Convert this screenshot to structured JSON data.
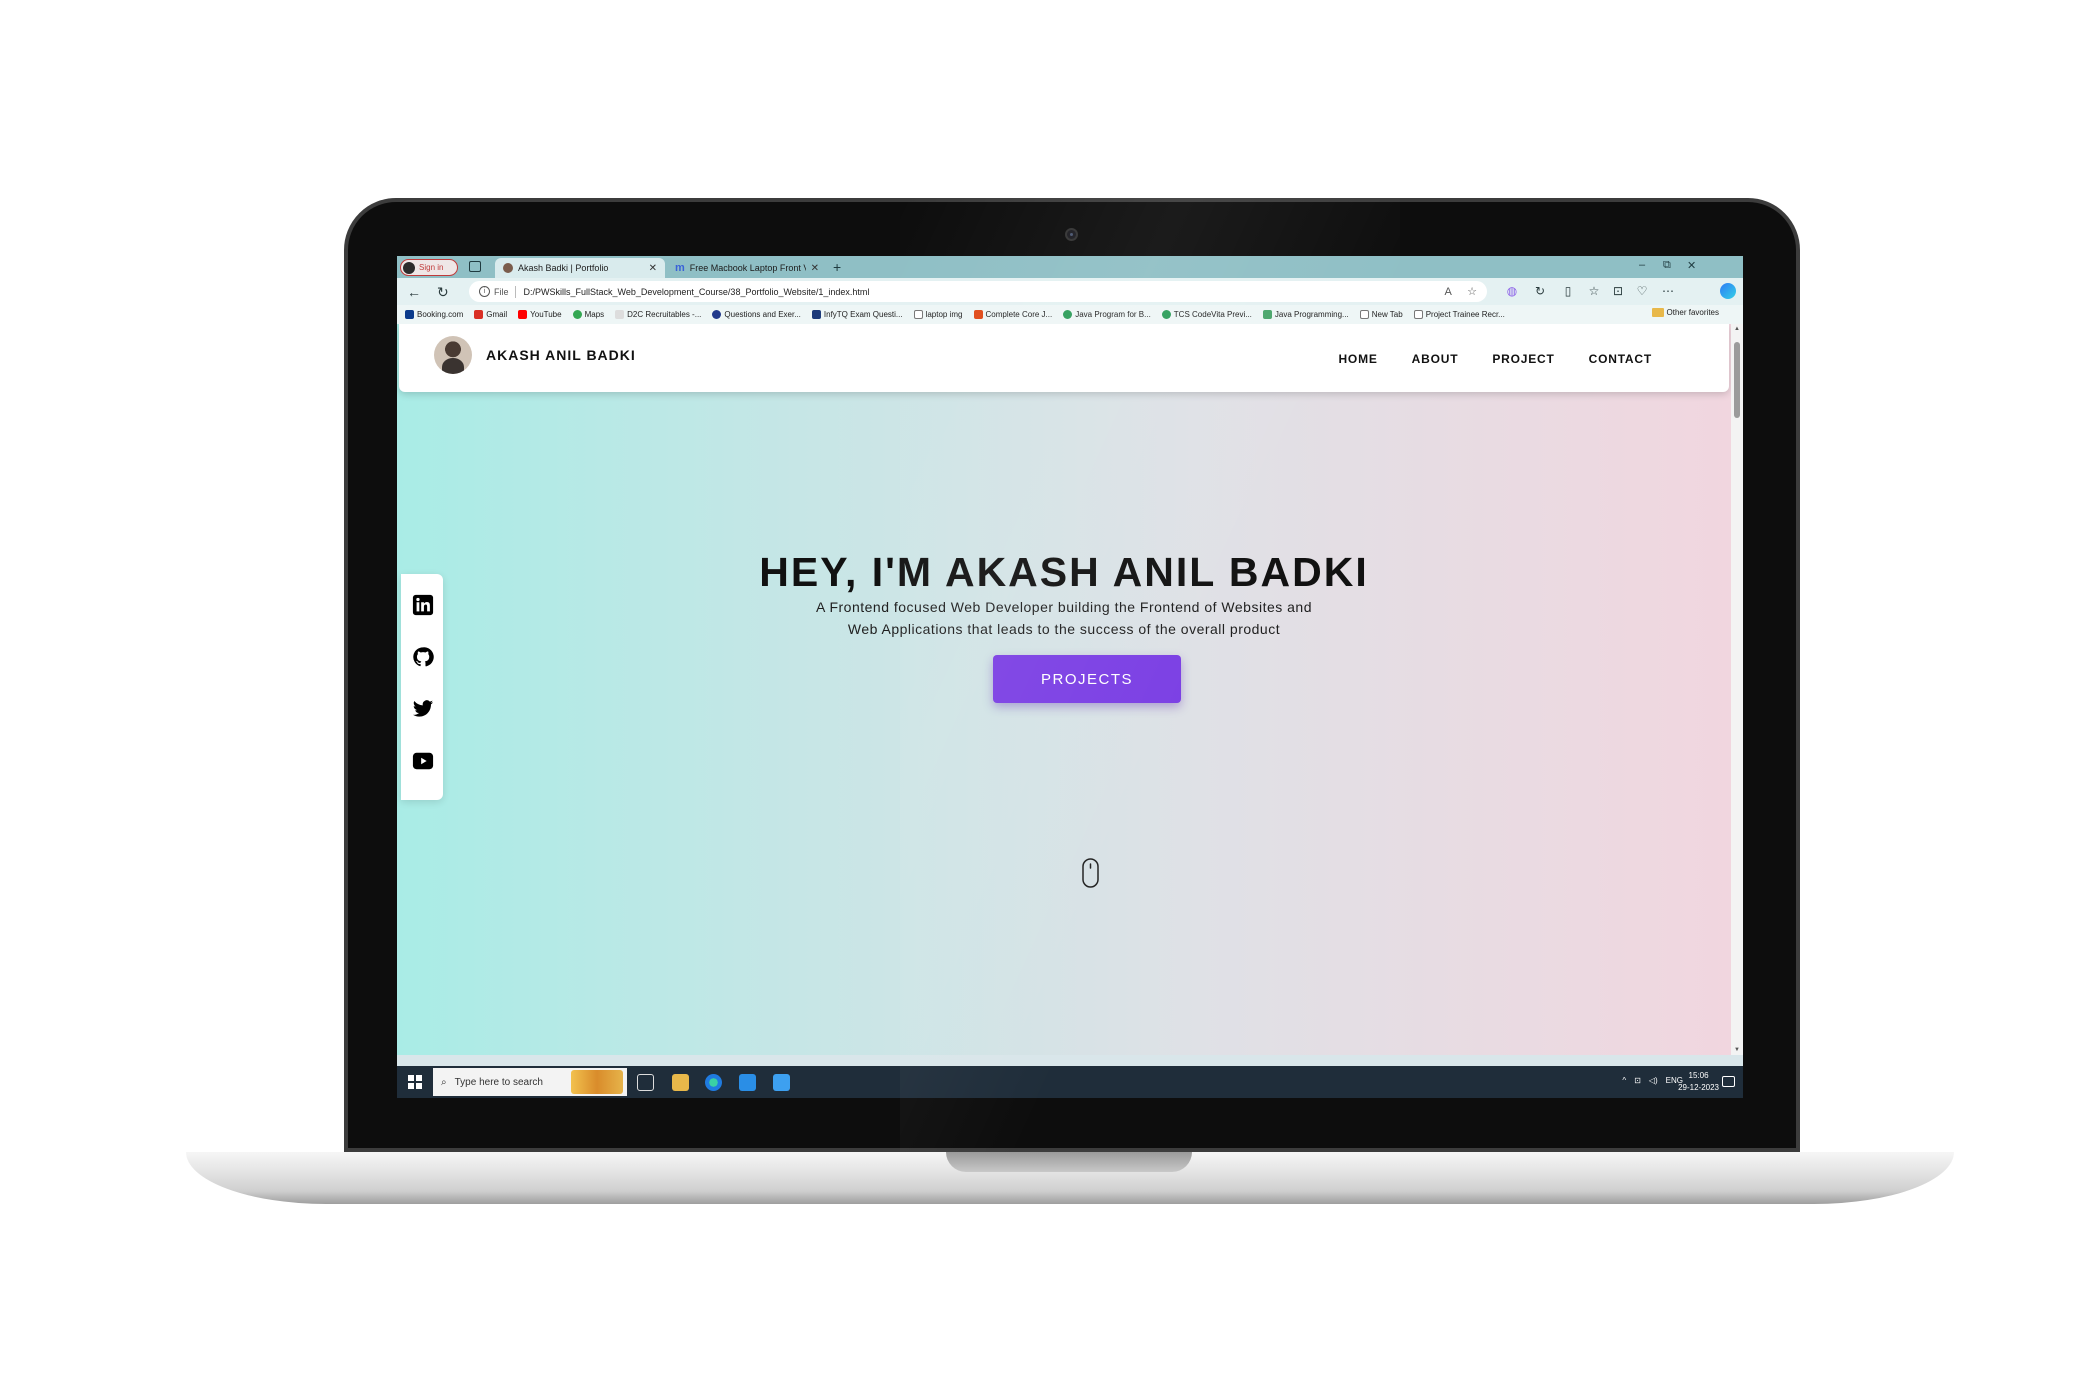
{
  "browser": {
    "signin_label": "Sign in",
    "tabs": [
      {
        "label": "Akash Badki | Portfolio",
        "active": true
      },
      {
        "label": "Free Macbook Laptop Front View",
        "active": false
      }
    ],
    "new_tab": "+",
    "window_controls": {
      "minimize": "–",
      "restore": "⧉",
      "close": "✕"
    },
    "address": {
      "scheme_label": "File",
      "url": "D:/PWSkills_FullStack_Web_Development_Course/38_Portfolio_Website/1_index.html",
      "read_aloud": "A",
      "favorite_star": "☆"
    },
    "toolbar_glyphs": {
      "back": "←",
      "refresh": "↻",
      "split": "▯",
      "favorites": "☆",
      "collections": "⊡",
      "performance": "♡",
      "more": "⋯",
      "extension": "◍"
    },
    "favorites": [
      {
        "label": "Booking.com",
        "color": "#0c3b8c"
      },
      {
        "label": "Gmail",
        "color": "#d93025"
      },
      {
        "label": "YouTube",
        "color": "#ff0000"
      },
      {
        "label": "Maps",
        "color": "#34a853"
      },
      {
        "label": "D2C Recruitables -...",
        "color": "#cccccc"
      },
      {
        "label": "Questions and Exer...",
        "color": "#223a8c"
      },
      {
        "label": "InfyTQ Exam Questi...",
        "color": "#1c3a7a"
      },
      {
        "label": "laptop img",
        "color": "#777777"
      },
      {
        "label": "Complete Core J...",
        "color": "#e04b1a"
      },
      {
        "label": "Java Program for B...",
        "color": "#2e9e5b"
      },
      {
        "label": "TCS CodeVita Previ...",
        "color": "#2e9e5b"
      },
      {
        "label": "Java Programming...",
        "color": "#4aa56b"
      },
      {
        "label": "New Tab",
        "color": "#777777"
      },
      {
        "label": "Project Trainee Recr...",
        "color": "#777777"
      }
    ],
    "other_favorites": "Other favorites"
  },
  "site": {
    "brand_name": "AKASH ANIL BADKI",
    "nav": [
      "HOME",
      "ABOUT",
      "PROJECT",
      "CONTACT"
    ],
    "hero_title": "HEY, I'M AKASH ANIL BADKI",
    "hero_subtitle": "A Frontend focused Web Developer building the Frontend of Websites and Web Applications that leads to the success of the overall product",
    "cta_label": "PROJECTS",
    "social": [
      "linkedin-icon",
      "github-icon",
      "twitter-icon",
      "youtube-icon"
    ],
    "colors": {
      "cta": "#7b3fe4",
      "gradient_left": "#a9ece6",
      "gradient_right": "#f1d6df"
    }
  },
  "taskbar": {
    "search_placeholder": "Type here to search",
    "search_glyph": "⌕",
    "tray_glyphs": {
      "overflow": "^",
      "network": "⊡",
      "volume": "◁)"
    },
    "language": "ENG",
    "time": "15:06",
    "date": "29-12-2023"
  }
}
